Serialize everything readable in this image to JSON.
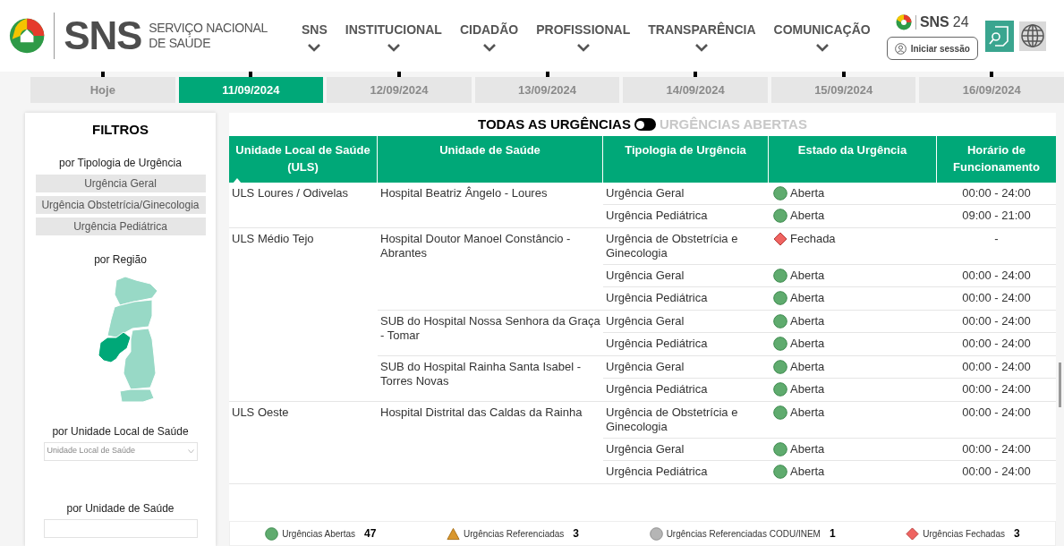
{
  "header": {
    "brand": "SNS",
    "brand_subtitle": [
      "SERVIÇO NACIONAL",
      "DE SAÚDE"
    ],
    "nav": [
      "SNS",
      "INSTITUCIONAL",
      "CIDADÃO",
      "PROFISSIONAL",
      "TRANSPARÊNCIA",
      "COMUNICAÇÃO"
    ],
    "sns24": {
      "name": "SNS",
      "number": "24",
      "login": "Iniciar sessão"
    }
  },
  "date_tabs": [
    {
      "label": "Hoje",
      "selected": false
    },
    {
      "label": "11/09/2024",
      "selected": true
    },
    {
      "label": "12/09/2024",
      "selected": false
    },
    {
      "label": "13/09/2024",
      "selected": false
    },
    {
      "label": "14/09/2024",
      "selected": false
    },
    {
      "label": "15/09/2024",
      "selected": false
    },
    {
      "label": "16/09/2024",
      "selected": false
    }
  ],
  "filters": {
    "title": "FILTROS",
    "typology_label": "por Tipologia de Urgência",
    "typologies": [
      "Urgência Geral",
      "Urgência Obstetrícia/Ginecologia",
      "Urgência Pediátrica"
    ],
    "region_label": "por Região",
    "regions": [
      {
        "selected": false
      },
      {
        "selected": false
      },
      {
        "selected": true
      },
      {
        "selected": false
      },
      {
        "selected": false
      }
    ],
    "uls_label": "por Unidade Local de Saúde",
    "uls_placeholder": "Unidade Local de Saúde",
    "unit_label": "por Unidade de Saúde"
  },
  "toggle": {
    "left": "TODAS AS URGÊNCIAS",
    "right": "URGÊNCIAS ABERTAS",
    "open_only": false
  },
  "table": {
    "columns": [
      "Unidade Local de Saúde (ULS)",
      "Unidade de Saúde",
      "Tipologia de Urgência",
      "Estado da Urgência",
      "Horário de Funcionamento"
    ],
    "groups": [
      {
        "uls": "ULS Loures / Odivelas",
        "units": [
          {
            "name": "Hospital Beatriz Ângelo - Loures",
            "services": [
              {
                "type": "Urgência Geral",
                "kind": "open",
                "status": "Aberta",
                "hours": "00:00 - 24:00"
              },
              {
                "type": "Urgência Pediátrica",
                "kind": "open",
                "status": "Aberta",
                "hours": "09:00 - 21:00"
              }
            ]
          }
        ]
      },
      {
        "uls": "ULS Médio Tejo",
        "units": [
          {
            "name": "Hospital Doutor Manoel Constâncio - Abrantes",
            "services": [
              {
                "type": "Urgência de Obstetrícia e Ginecologia",
                "kind": "closed",
                "status": "Fechada",
                "hours": "-"
              },
              {
                "type": "Urgência Geral",
                "kind": "open",
                "status": "Aberta",
                "hours": "00:00 - 24:00"
              },
              {
                "type": "Urgência Pediátrica",
                "kind": "open",
                "status": "Aberta",
                "hours": "00:00 - 24:00"
              }
            ]
          },
          {
            "name": "SUB do Hospital Nossa Senhora da Graça - Tomar",
            "services": [
              {
                "type": "Urgência Geral",
                "kind": "open",
                "status": "Aberta",
                "hours": "00:00 - 24:00"
              },
              {
                "type": "Urgência Pediátrica",
                "kind": "open",
                "status": "Aberta",
                "hours": "00:00 - 24:00"
              }
            ]
          },
          {
            "name": "SUB do Hospital Rainha Santa Isabel - Torres Novas",
            "services": [
              {
                "type": "Urgência Geral",
                "kind": "open",
                "status": "Aberta",
                "hours": "00:00 - 24:00"
              },
              {
                "type": "Urgência Pediátrica",
                "kind": "open",
                "status": "Aberta",
                "hours": "00:00 - 24:00"
              }
            ]
          }
        ]
      },
      {
        "uls": "ULS Oeste",
        "units": [
          {
            "name": "Hospital Distrital das Caldas da Rainha",
            "services": [
              {
                "type": "Urgência de Obstetrícia e Ginecologia",
                "kind": "open",
                "status": "Aberta",
                "hours": "00:00 - 24:00"
              },
              {
                "type": "Urgência Geral",
                "kind": "open",
                "status": "Aberta",
                "hours": "00:00 - 24:00"
              },
              {
                "type": "Urgência Pediátrica",
                "kind": "open",
                "status": "Aberta",
                "hours": "00:00 - 24:00"
              }
            ]
          }
        ]
      }
    ]
  },
  "legend": [
    {
      "kind": "open",
      "label": "Urgências Abertas",
      "count": "47"
    },
    {
      "kind": "referred",
      "label": "Urgências Referenciadas",
      "count": "3"
    },
    {
      "kind": "codu",
      "label": "Urgências Referenciadas CODU/INEM",
      "count": "1"
    },
    {
      "kind": "closed",
      "label": "Urgências Fechadas",
      "count": "3"
    }
  ]
}
